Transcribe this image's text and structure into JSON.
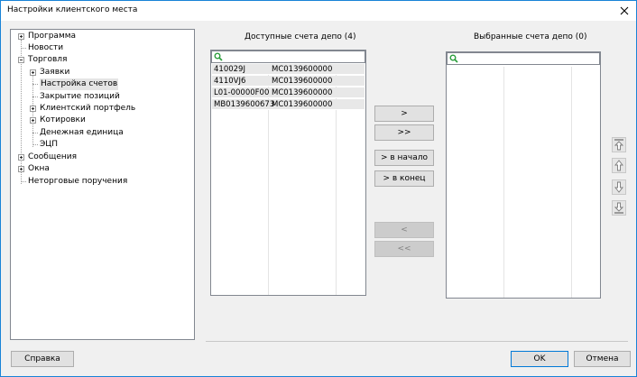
{
  "window": {
    "title": "Настройки клиентского места"
  },
  "tree": {
    "program": "Программа",
    "news": "Новости",
    "trading": "Торговля",
    "orders": "Заявки",
    "account_settings": "Настройка счетов",
    "close_positions": "Закрытие позиций",
    "client_portfolio": "Клиентский портфель",
    "quotes": "Котировки",
    "currency_unit": "Денежная единица",
    "eds": "ЭЦП",
    "messages": "Сообщения",
    "windows": "Окна",
    "nontrade_orders": "Неторговые поручения"
  },
  "available": {
    "title": "Доступные счета депо (4)",
    "search_value": "",
    "rows": [
      {
        "account": "410029J",
        "code": "MC0139600000"
      },
      {
        "account": "4110VJ6",
        "code": "MC0139600000"
      },
      {
        "account": "L01-00000F00",
        "code": "MC0139600000"
      },
      {
        "account": "MB0139600673",
        "code": "MC0139600000"
      }
    ]
  },
  "selected": {
    "title": "Выбранные счета депо (0)",
    "search_value": ""
  },
  "transfer_buttons": {
    "add_one": ">",
    "add_all": ">>",
    "to_start": "> в начало",
    "to_end": "> в конец",
    "remove_one": "<",
    "remove_all": "<<"
  },
  "footer": {
    "help": "Справка",
    "ok": "OK",
    "cancel": "Отмена"
  },
  "icons": {
    "close": "close-icon",
    "search": "search-icon",
    "move_top": "move-to-top-icon",
    "move_up": "move-up-icon",
    "move_down": "move-down-icon",
    "move_bottom": "move-to-bottom-icon"
  },
  "colors": {
    "window_border": "#1883d7",
    "search_icon": "#2a9d3b",
    "row_bg": "#e8e8e8",
    "ok_border": "#0078d7"
  }
}
